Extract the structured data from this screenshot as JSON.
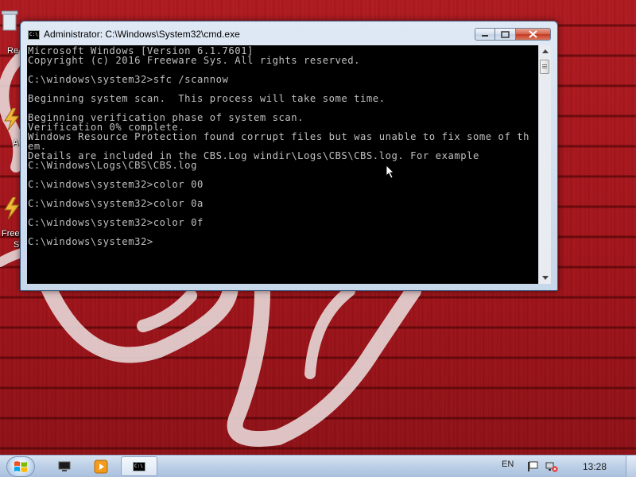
{
  "desktop": {
    "icons": [
      {
        "label": "Re"
      },
      {
        "label": "A"
      },
      {
        "label": "Free"
      },
      {
        "label": "S"
      }
    ]
  },
  "window": {
    "title": "Administrator: C:\\Windows\\System32\\cmd.exe",
    "icon_text": "C:\\",
    "console_lines": [
      "Microsoft Windows [Version 6.1.7601]",
      "Copyright (c) 2016 Freeware Sys. All rights reserved.",
      "",
      "C:\\windows\\system32>sfc /scannow",
      "",
      "Beginning system scan.  This process will take some time.",
      "",
      "Beginning verification phase of system scan.",
      "Verification 0% complete.",
      "Windows Resource Protection found corrupt files but was unable to fix some of th",
      "em.",
      "Details are included in the CBS.Log windir\\Logs\\CBS\\CBS.log. For example",
      "C:\\Windows\\Logs\\CBS\\CBS.log",
      "",
      "C:\\windows\\system32>color 00",
      "",
      "C:\\windows\\system32>color 0a",
      "",
      "C:\\windows\\system32>color 0f",
      "",
      "C:\\windows\\system32>"
    ],
    "console_text_color": "#c0c0c0",
    "console_bg_color": "#000000"
  },
  "taskbar": {
    "language": "EN",
    "clock": "13:28",
    "buttons": [
      {
        "name": "computer-icon"
      },
      {
        "name": "media-player-icon"
      },
      {
        "name": "cmd-icon",
        "icon_text": "C:\\"
      }
    ]
  }
}
